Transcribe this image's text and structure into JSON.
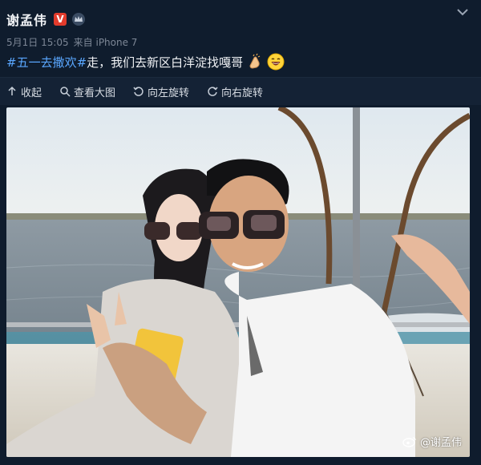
{
  "post": {
    "username": "谢孟伟",
    "badge": "V",
    "date": "5月1日 15:05",
    "source": "来自 iPhone 7",
    "hashtag": "#五一去撒欢#",
    "text": " 走，我们去新区白洋淀找嘎哥"
  },
  "toolbar": {
    "collapse": "收起",
    "view_large": "查看大图",
    "rotate_left": "向左旋转",
    "rotate_right": "向右旋转"
  },
  "photo": {
    "watermark": "@谢孟伟"
  },
  "colors": {
    "background": "#0f1c2d",
    "hashtag": "#5aa7ff",
    "verified": "#e23b2c"
  }
}
